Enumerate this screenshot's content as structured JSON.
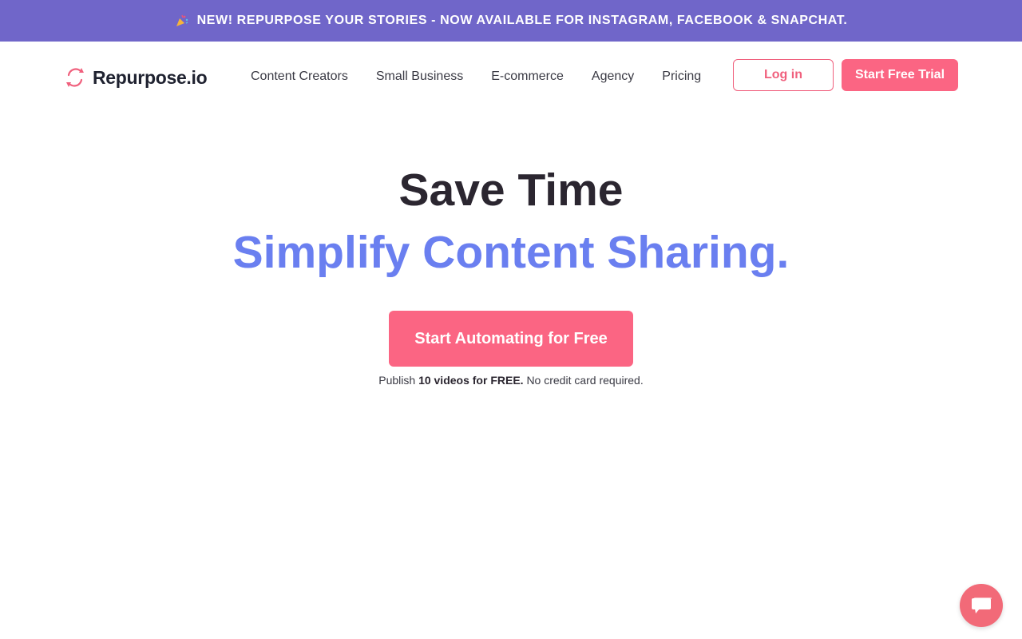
{
  "announcement": {
    "text": "NEW! REPURPOSE YOUR STORIES - NOW AVAILABLE FOR INSTAGRAM, FACEBOOK & SNAPCHAT.",
    "icon": "party-popper-icon"
  },
  "header": {
    "brand": "Repurpose.io",
    "nav": [
      {
        "label": "Content Creators"
      },
      {
        "label": "Small Business"
      },
      {
        "label": "E-commerce"
      },
      {
        "label": "Agency"
      },
      {
        "label": "Pricing"
      }
    ],
    "login_label": "Log in",
    "trial_label": "Start Free Trial"
  },
  "hero": {
    "title": "Save Time",
    "subtitle": "Simplify Content Sharing.",
    "cta_label": "Start Automating for Free",
    "note_prefix": "Publish",
    "note_bold": "10 videos for FREE.",
    "note_suffix": "No credit card required."
  },
  "chat": {
    "icon": "chat-bubble-icon"
  },
  "colors": {
    "banner": "#7066c9",
    "accent": "#fb6583",
    "subtitle": "#6a7ff0",
    "title": "#2b2630"
  }
}
